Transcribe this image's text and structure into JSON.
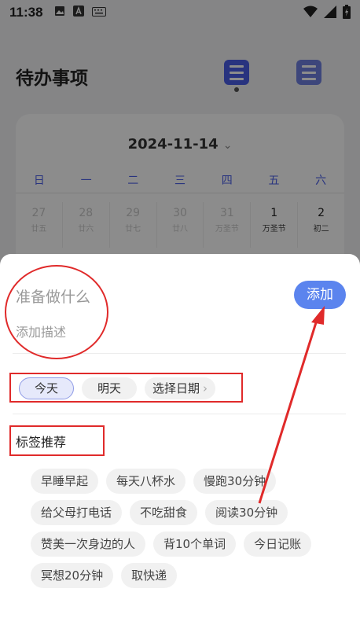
{
  "status_bar": {
    "time": "11:38"
  },
  "header": {
    "title": "待办事项"
  },
  "calendar": {
    "current_date": "2024-11-14",
    "weekdays": [
      "日",
      "一",
      "二",
      "三",
      "四",
      "五",
      "六"
    ],
    "week": [
      {
        "day": "27",
        "sub": "廿五"
      },
      {
        "day": "28",
        "sub": "廿六"
      },
      {
        "day": "29",
        "sub": "廿七"
      },
      {
        "day": "30",
        "sub": "廿八"
      },
      {
        "day": "31",
        "sub": "万圣节"
      },
      {
        "day": "1",
        "sub": "万圣节"
      },
      {
        "day": "2",
        "sub": "初二"
      }
    ]
  },
  "sheet": {
    "title_placeholder": "准备做什么",
    "desc_placeholder": "添加描述",
    "add_label": "添加",
    "date_options": [
      "今天",
      "明天",
      "选择日期"
    ],
    "tags_title": "标签推荐",
    "tags": [
      "早睡早起",
      "每天八杯水",
      "慢跑30分钟",
      "给父母打电话",
      "不吃甜食",
      "阅读30分钟",
      "赞美一次身边的人",
      "背10个单词",
      "今日记账",
      "冥想20分钟",
      "取快递"
    ]
  }
}
